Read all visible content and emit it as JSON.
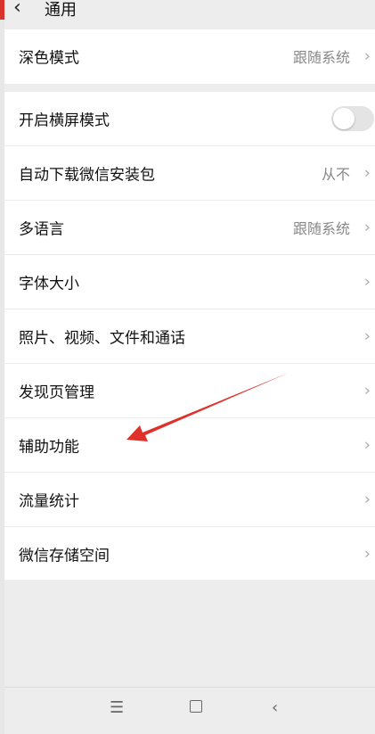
{
  "header": {
    "back_icon": "chevron-left-icon",
    "title": "通用"
  },
  "settings": {
    "dark_mode": {
      "label": "深色模式",
      "value": "跟随系统"
    },
    "items": [
      {
        "label": "开启横屏模式",
        "toggle": false
      },
      {
        "label": "自动下载微信安装包",
        "value": "从不"
      },
      {
        "label": "多语言",
        "value": "跟随系统"
      },
      {
        "label": "字体大小",
        "value": ""
      },
      {
        "label": "照片、视频、文件和通话",
        "value": ""
      },
      {
        "label": "发现页管理",
        "value": ""
      },
      {
        "label": "辅助功能",
        "value": ""
      },
      {
        "label": "流量统计",
        "value": ""
      },
      {
        "label": "微信存储空间",
        "value": ""
      }
    ]
  },
  "annotation": {
    "arrow_color": "#e0302a",
    "points_to": "辅助功能"
  },
  "navbar": {
    "icons": [
      "menu-icon",
      "home-icon",
      "back-icon"
    ]
  }
}
